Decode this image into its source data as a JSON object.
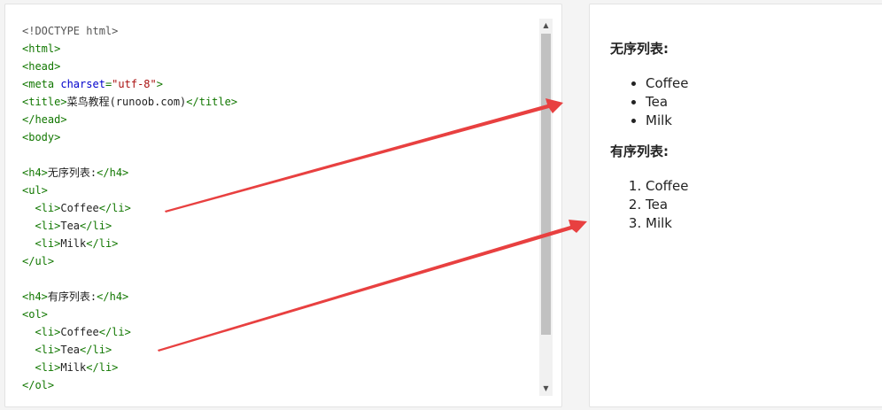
{
  "editor": {
    "lines": [
      [
        {
          "t": "<!DOCTYPE html>",
          "c": "doctype"
        }
      ],
      [
        {
          "t": "<html>",
          "c": "tag"
        }
      ],
      [
        {
          "t": "<head>",
          "c": "tag"
        }
      ],
      [
        {
          "t": "<meta ",
          "c": "tag"
        },
        {
          "t": "charset",
          "c": "attr"
        },
        {
          "t": "=",
          "c": "tag"
        },
        {
          "t": "\"utf-8\"",
          "c": "str"
        },
        {
          "t": ">",
          "c": "tag"
        }
      ],
      [
        {
          "t": "<title>",
          "c": "tag"
        },
        {
          "t": "菜鸟教程(runoob.com)",
          "c": "txt"
        },
        {
          "t": "</title>",
          "c": "tag"
        }
      ],
      [
        {
          "t": "</head>",
          "c": "tag"
        }
      ],
      [
        {
          "t": "<body>",
          "c": "tag"
        }
      ],
      [],
      [
        {
          "t": "<h4>",
          "c": "tag"
        },
        {
          "t": "无序列表:",
          "c": "txt"
        },
        {
          "t": "</h4>",
          "c": "tag"
        }
      ],
      [
        {
          "t": "<ul>",
          "c": "tag"
        }
      ],
      [
        {
          "t": "  ",
          "c": "txt"
        },
        {
          "t": "<li>",
          "c": "tag"
        },
        {
          "t": "Coffee",
          "c": "txt"
        },
        {
          "t": "</li>",
          "c": "tag"
        }
      ],
      [
        {
          "t": "  ",
          "c": "txt"
        },
        {
          "t": "<li>",
          "c": "tag"
        },
        {
          "t": "Tea",
          "c": "txt"
        },
        {
          "t": "</li>",
          "c": "tag"
        }
      ],
      [
        {
          "t": "  ",
          "c": "txt"
        },
        {
          "t": "<li>",
          "c": "tag"
        },
        {
          "t": "Milk",
          "c": "txt"
        },
        {
          "t": "</li>",
          "c": "tag"
        }
      ],
      [
        {
          "t": "</ul>",
          "c": "tag"
        }
      ],
      [],
      [
        {
          "t": "<h4>",
          "c": "tag"
        },
        {
          "t": "有序列表:",
          "c": "txt"
        },
        {
          "t": "</h4>",
          "c": "tag"
        }
      ],
      [
        {
          "t": "<ol>",
          "c": "tag"
        }
      ],
      [
        {
          "t": "  ",
          "c": "txt"
        },
        {
          "t": "<li>",
          "c": "tag"
        },
        {
          "t": "Coffee",
          "c": "txt"
        },
        {
          "t": "</li>",
          "c": "tag"
        }
      ],
      [
        {
          "t": "  ",
          "c": "txt"
        },
        {
          "t": "<li>",
          "c": "tag"
        },
        {
          "t": "Tea",
          "c": "txt"
        },
        {
          "t": "</li>",
          "c": "tag"
        }
      ],
      [
        {
          "t": "  ",
          "c": "txt"
        },
        {
          "t": "<li>",
          "c": "tag"
        },
        {
          "t": "Milk",
          "c": "txt"
        },
        {
          "t": "</li>",
          "c": "tag"
        }
      ],
      [
        {
          "t": "</ol>",
          "c": "tag"
        }
      ]
    ]
  },
  "scrollbar": {
    "up_arrow": "▲",
    "down_arrow": "▼"
  },
  "result": {
    "unordered_heading": "无序列表:",
    "unordered_items": [
      "Coffee",
      "Tea",
      "Milk"
    ],
    "ordered_heading": "有序列表:",
    "ordered_items": [
      "Coffee",
      "Tea",
      "Milk"
    ]
  },
  "annotation_color": "#e84040"
}
